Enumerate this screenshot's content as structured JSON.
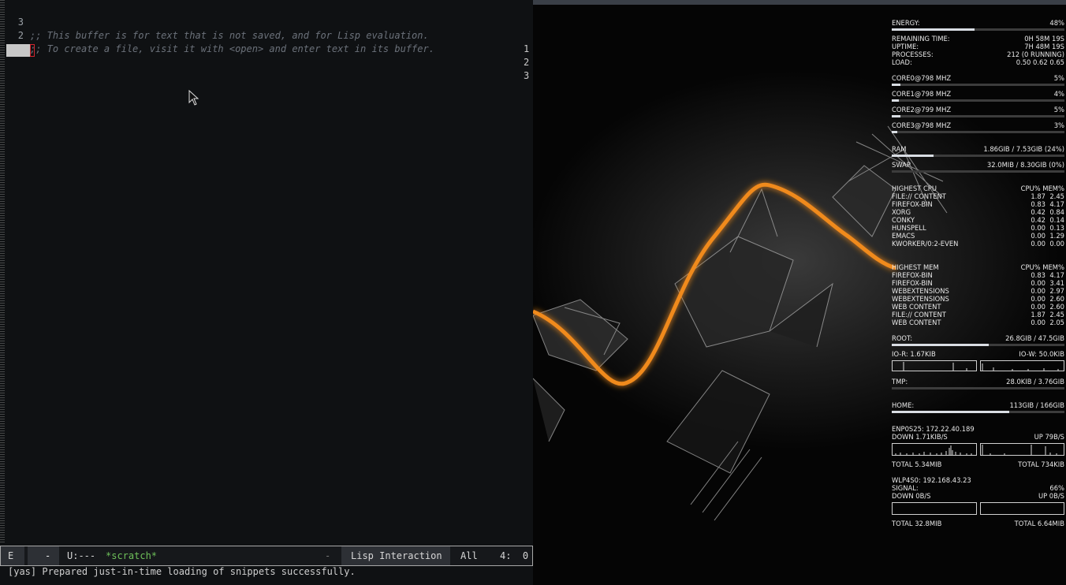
{
  "emacs": {
    "buffer_lines": [
      {
        "num": "3",
        "text": ";; This buffer is for text that is not saved, and for Lisp evaluation.",
        "right": "1"
      },
      {
        "num": "2",
        "text": ";; To create a file, visit it with <open> and enter text in its buffer.",
        "right": "2"
      },
      {
        "num": "1",
        "text": "",
        "right": "3"
      }
    ],
    "modeline": {
      "evil_state": "E",
      "modified": "-",
      "status": "U:---",
      "buffer_name": "*scratch*",
      "dash": "-",
      "major_mode": "Lisp Interaction",
      "position": "All",
      "linecol": "4:  0"
    },
    "echo": "[yas] Prepared just-in-time loading of snippets successfully.",
    "colors": {
      "buffer_name": "#6ec05a",
      "comment": "#6b717a",
      "cursor_edge": "#d0272f"
    }
  },
  "conky": {
    "energy": {
      "label": "ENERGY:",
      "value": "48%",
      "fraction": 0.48
    },
    "remaining": {
      "label": "REMAINING TIME:",
      "value": "0H 58M 19S"
    },
    "uptime": {
      "label": "UPTIME:",
      "value": "7H 48M 19S"
    },
    "processes": {
      "label": "PROCESSES:",
      "value": "212 (0 RUNNING)"
    },
    "load": {
      "label": "LOAD:",
      "value": "0.50 0.62 0.65"
    },
    "cores": [
      {
        "label": "CORE0@798 MHZ",
        "value": "5%",
        "fraction": 0.05
      },
      {
        "label": "CORE1@798 MHZ",
        "value": "4%",
        "fraction": 0.04
      },
      {
        "label": "CORE2@799 MHZ",
        "value": "5%",
        "fraction": 0.05
      },
      {
        "label": "CORE3@798 MHZ",
        "value": "3%",
        "fraction": 0.03
      }
    ],
    "ram": {
      "label": "RAM",
      "value": "1.86GIB / 7.53GIB (24%)",
      "fraction": 0.24
    },
    "swap": {
      "label": "SWAP",
      "value": "32.0MIB / 8.30GIB (0%)",
      "fraction": 0.0
    },
    "cpu_table": {
      "title": "HIGHEST CPU",
      "header": "CPU% MEM%",
      "rows": [
        {
          "name": "FILE:// CONTENT",
          "cpu": "1.87",
          "mem": "2.45"
        },
        {
          "name": "FIREFOX-BIN",
          "cpu": "0.83",
          "mem": "4.17"
        },
        {
          "name": "XORG",
          "cpu": "0.42",
          "mem": "0.84"
        },
        {
          "name": "CONKY",
          "cpu": "0.42",
          "mem": "0.14"
        },
        {
          "name": "HUNSPELL",
          "cpu": "0.00",
          "mem": "0.13"
        },
        {
          "name": "EMACS",
          "cpu": "0.00",
          "mem": "1.29"
        },
        {
          "name": "KWORKER/0:2-EVEN",
          "cpu": "0.00",
          "mem": "0.00"
        }
      ]
    },
    "mem_table": {
      "title": "HIGHEST MEM",
      "header": "CPU% MEM%",
      "rows": [
        {
          "name": "FIREFOX-BIN",
          "cpu": "0.83",
          "mem": "4.17"
        },
        {
          "name": "FIREFOX-BIN",
          "cpu": "0.00",
          "mem": "3.41"
        },
        {
          "name": "WEBEXTENSIONS",
          "cpu": "0.00",
          "mem": "2.97"
        },
        {
          "name": "WEBEXTENSIONS",
          "cpu": "0.00",
          "mem": "2.60"
        },
        {
          "name": "WEB CONTENT",
          "cpu": "0.00",
          "mem": "2.60"
        },
        {
          "name": "FILE:// CONTENT",
          "cpu": "1.87",
          "mem": "2.45"
        },
        {
          "name": "WEB CONTENT",
          "cpu": "0.00",
          "mem": "2.05"
        }
      ]
    },
    "root": {
      "label": "ROOT:",
      "value": "26.8GIB / 47.5GIB",
      "fraction": 0.56
    },
    "io": {
      "read": "IO-R: 1.67KIB",
      "write": "IO-W: 50.0KIB"
    },
    "tmp": {
      "label": "TMP:",
      "value": "28.0KIB / 3.76GIB",
      "fraction": 0.0
    },
    "home": {
      "label": "HOME:",
      "value": "113GIB / 166GIB",
      "fraction": 0.68
    },
    "eth": {
      "iface": "ENP0S25: 172.22.40.189",
      "down": "DOWN 1.71KIB/S",
      "up": "UP 79B/S",
      "total_down": "TOTAL 5.34MIB",
      "total_up": "TOTAL 734KIB"
    },
    "wifi": {
      "iface": "WLP4S0: 192.168.43.23",
      "signal_label": "SIGNAL:",
      "signal": "66%",
      "down": "DOWN 0B/S",
      "up": "UP 0B/S",
      "total_down": "TOTAL 32.8MIB",
      "total_up": "TOTAL 6.64MIB"
    }
  }
}
